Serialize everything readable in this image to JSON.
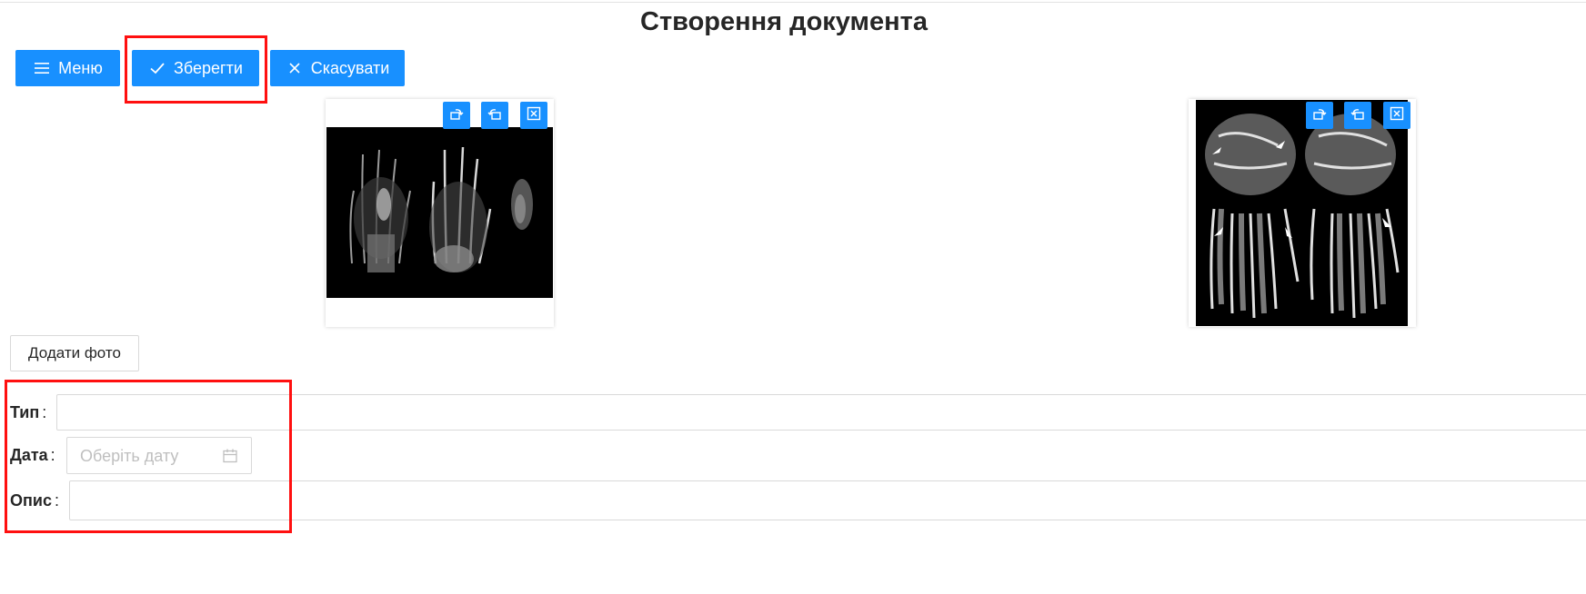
{
  "page": {
    "title": "Створення документа"
  },
  "toolbar": {
    "menu_label": "Меню",
    "save_label": "Зберегти",
    "cancel_label": "Скасувати"
  },
  "photos": [
    {
      "name": "hand-mri-photo-1",
      "actions": [
        "rotate-left-icon",
        "rotate-right-icon",
        "remove-icon"
      ]
    },
    {
      "name": "hand-mri-photo-2",
      "actions": [
        "rotate-left-icon",
        "rotate-right-icon",
        "remove-icon"
      ]
    }
  ],
  "add_photo_label": "Додати фото",
  "form": {
    "type": {
      "label": "Тип",
      "value": ""
    },
    "date": {
      "label": "Дата",
      "value": "",
      "placeholder": "Оберіть дату"
    },
    "description": {
      "label": "Опис",
      "value": ""
    },
    "colon": ":"
  },
  "colors": {
    "primary": "#1890ff",
    "highlight": "#ff1010",
    "border": "#d9d9d9",
    "placeholder": "#bfbfbf",
    "text": "#262626"
  }
}
